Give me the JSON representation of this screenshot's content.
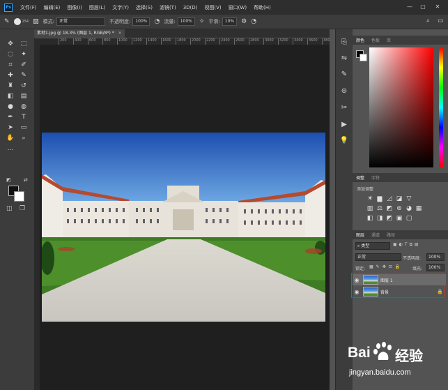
{
  "menubar": {
    "logo": "Ps",
    "items": [
      "文件(F)",
      "编辑(E)",
      "图像(I)",
      "图层(L)",
      "文字(Y)",
      "选择(S)",
      "滤镜(T)",
      "3D(D)",
      "视图(V)",
      "窗口(W)",
      "帮助(H)"
    ]
  },
  "options": {
    "brush_size": "154",
    "mode_label": "模式:",
    "mode_value": "正常",
    "opacity_label": "不透明度:",
    "opacity_value": "100%",
    "flow_label": "流量:",
    "flow_value": "100%",
    "smooth_label": "平滑:",
    "smooth_value": "10%"
  },
  "document": {
    "tab_title": "素材1.jpg @ 18.3% (图层 1, RGB/8*) *",
    "ruler_ticks": [
      "200",
      "400",
      "600",
      "800",
      "1000",
      "1200",
      "1400",
      "1600",
      "1800",
      "2000",
      "2200",
      "2400",
      "2600",
      "2800",
      "3000",
      "3200",
      "3400",
      "3600",
      "3800"
    ]
  },
  "panels": {
    "color_tabs": [
      "颜色",
      "色板",
      "库"
    ],
    "adjust_tabs": [
      "调整",
      "字符"
    ],
    "adjust_add_label": "添加调整",
    "layers_tabs": [
      "图层",
      "通道",
      "路径"
    ],
    "filter_kind": "类型",
    "blend_mode": "正常",
    "opacity_label": "不透明度:",
    "opacity_value": "100%",
    "lock_label": "锁定:",
    "fill_label": "填充:",
    "fill_value": "100%",
    "layers": [
      {
        "name": "图层 1"
      },
      {
        "name": "背景"
      }
    ]
  },
  "watermark": {
    "brand": "Bai",
    "brand2": "经验",
    "url": "jingyan.baidu.com"
  },
  "colors": {
    "app_bg": "#535353",
    "canvas_bg": "#201f1f",
    "selection_outline": "#c0392b"
  }
}
